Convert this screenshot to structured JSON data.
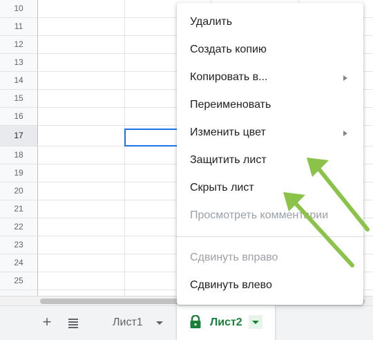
{
  "grid": {
    "rows": [
      "10",
      "11",
      "12",
      "13",
      "14",
      "15",
      "16",
      "17",
      "18",
      "19",
      "20",
      "21",
      "22",
      "23",
      "24",
      "25"
    ],
    "active_row": "17"
  },
  "context_menu": {
    "items": [
      {
        "label": "Удалить",
        "enabled": true,
        "submenu": false
      },
      {
        "label": "Создать копию",
        "enabled": true,
        "submenu": false
      },
      {
        "label": "Копировать в...",
        "enabled": true,
        "submenu": true
      },
      {
        "label": "Переименовать",
        "enabled": true,
        "submenu": false
      },
      {
        "label": "Изменить цвет",
        "enabled": true,
        "submenu": true
      },
      {
        "label": "Защитить лист",
        "enabled": true,
        "submenu": false
      },
      {
        "label": "Скрыть лист",
        "enabled": true,
        "submenu": false
      },
      {
        "label": "Просмотреть комментарии",
        "enabled": false,
        "submenu": false
      },
      {
        "label": "Сдвинуть вправо",
        "enabled": false,
        "submenu": false
      },
      {
        "label": "Сдвинуть влево",
        "enabled": true,
        "submenu": false
      }
    ]
  },
  "tabbar": {
    "add_icon": "plus-icon",
    "list_icon": "menu-lines-icon",
    "sheets": [
      {
        "label": "Лист1",
        "active": false,
        "protected": false
      },
      {
        "label": "Лист2",
        "active": true,
        "protected": true
      }
    ]
  },
  "colors": {
    "active_tab_text": "#188038",
    "selection_border": "#1a73e8",
    "annotation_arrow": "#8bc34a"
  }
}
